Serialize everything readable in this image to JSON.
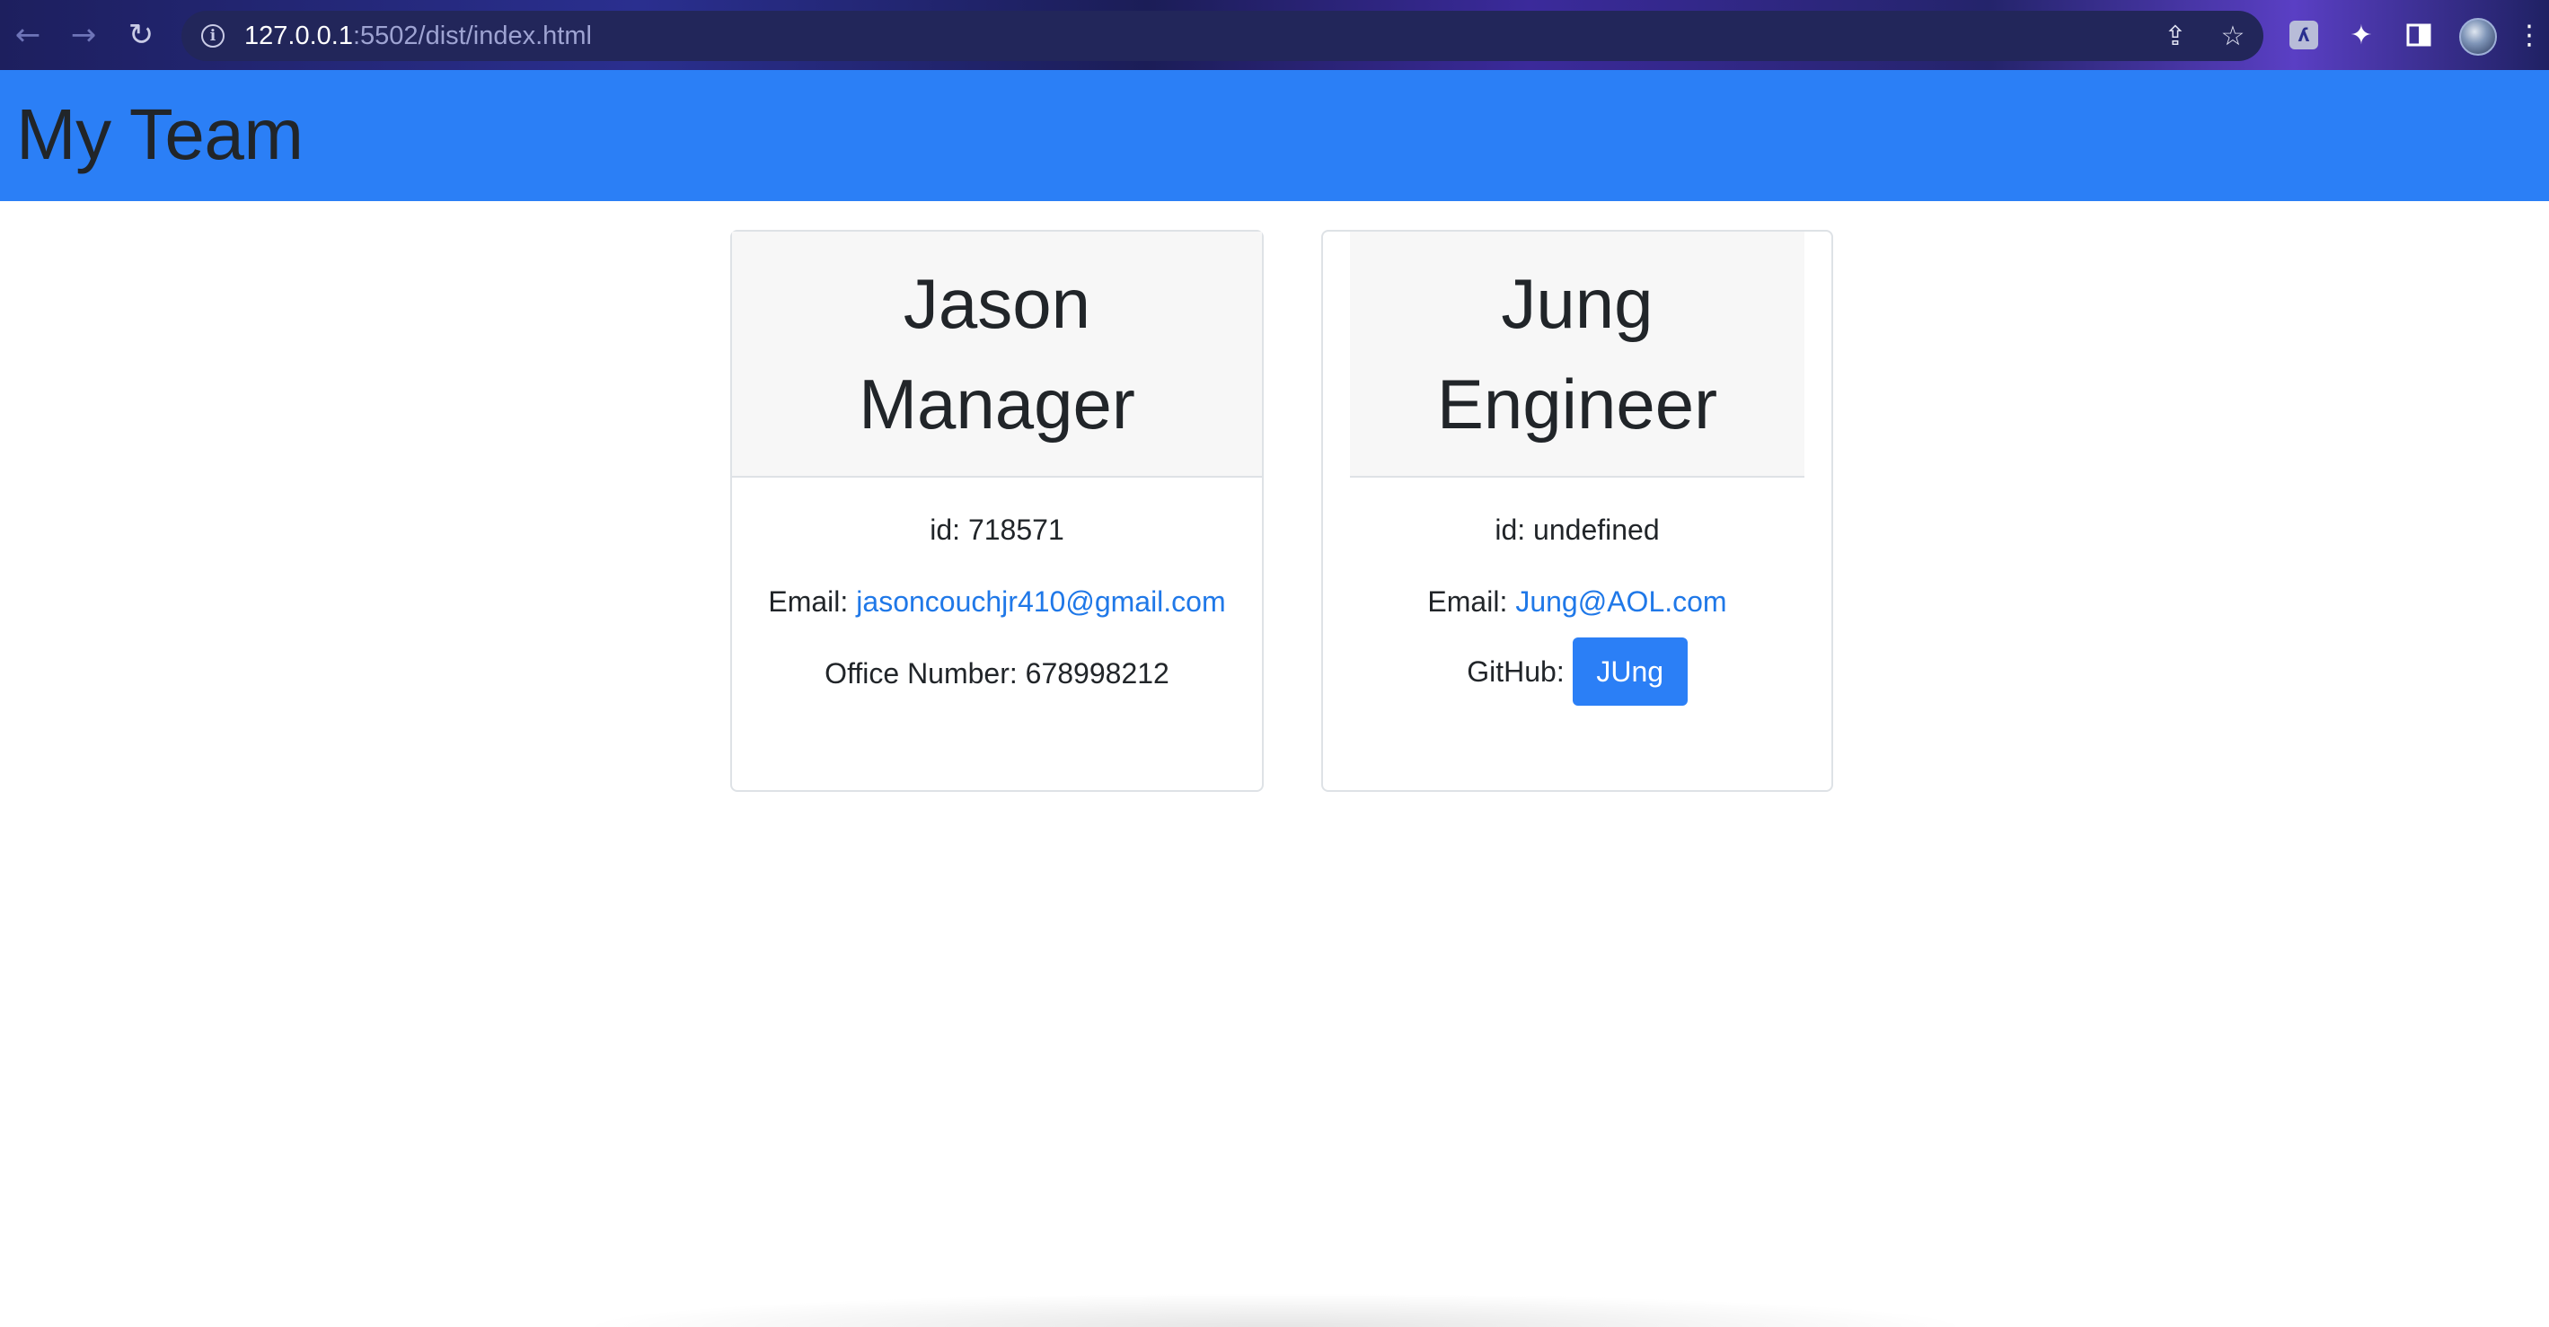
{
  "browser": {
    "url_host": "127.0.0.1",
    "url_rest": ":5502/dist/index.html",
    "icons": {
      "back": "arrow-left-icon",
      "forward": "arrow-right-icon",
      "reload": "reload-icon",
      "info": "info-icon",
      "share": "share-icon",
      "bookmark": "star-icon",
      "extension": "extension-icon",
      "extensions_menu": "puzzle-icon",
      "side_panel": "side-panel-icon",
      "profile": "avatar",
      "menu": "kebab-menu-icon"
    }
  },
  "header": {
    "title": "My Team",
    "background": "#2b7ff6"
  },
  "cards": [
    {
      "name": "Jason",
      "role": "Manager",
      "id_label": "id:",
      "id_value": "718571",
      "email_label": "Email:",
      "email": "jasoncouchjr410@gmail.com",
      "extra_label": "Office Number:",
      "extra_value": "678998212"
    },
    {
      "name": "Jung",
      "role": "Engineer",
      "id_label": "id:",
      "id_value": "undefined",
      "email_label": "Email:",
      "email": "Jung@AOL.com",
      "extra_label": "GitHub:",
      "extra_value": "JUng"
    }
  ],
  "colors": {
    "link": "#1f78e8",
    "button": "#2b7ff6",
    "card_header_bg": "#f7f7f7"
  }
}
